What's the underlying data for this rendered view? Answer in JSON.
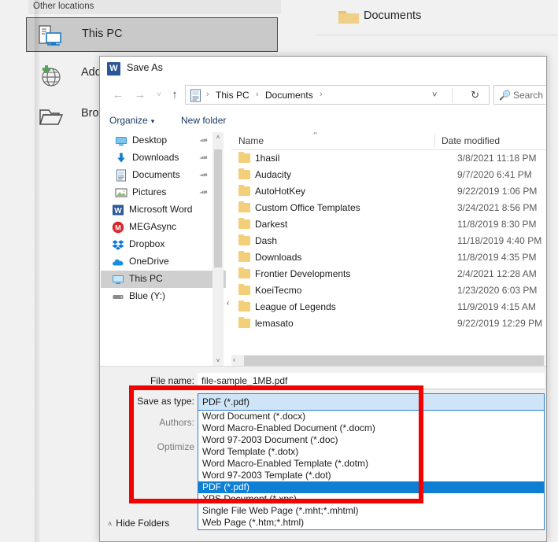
{
  "backstage": {
    "other_locations_label": "Other locations",
    "places": [
      {
        "label": "This PC",
        "icon": "this-pc-icon",
        "selected": true
      },
      {
        "label": "Add a Place",
        "icon": "add-place-globe-icon",
        "selected": false
      },
      {
        "label": "Browse",
        "icon": "browse-folder-icon",
        "selected": false
      }
    ],
    "current_folder": {
      "label": "Documents",
      "icon": "folder-icon"
    }
  },
  "dialog": {
    "title": "Save As",
    "app_icon": "word-icon",
    "app_icon_letter": "W",
    "nav": {
      "back": "←",
      "forward": "→",
      "recent": "˅",
      "up": "↑"
    },
    "address": {
      "icon": "documents-library-icon",
      "crumbs": [
        "This PC",
        "Documents"
      ],
      "separator": "›",
      "dropdown_caret": "˅",
      "refresh": "↻"
    },
    "search": {
      "icon": "search-icon",
      "placeholder": "Search D"
    },
    "commands": {
      "organize": "Organize",
      "organize_caret": "▾",
      "new_folder": "New folder"
    },
    "nav_pane": {
      "items": [
        {
          "label": "Desktop",
          "icon": "desktop-icon",
          "pinned": true,
          "child": true,
          "selected": false
        },
        {
          "label": "Downloads",
          "icon": "downloads-icon",
          "pinned": true,
          "child": true,
          "selected": false
        },
        {
          "label": "Documents",
          "icon": "documents-icon",
          "pinned": true,
          "child": true,
          "selected": false
        },
        {
          "label": "Pictures",
          "icon": "pictures-icon",
          "pinned": true,
          "child": true,
          "selected": false
        },
        {
          "label": "Microsoft Word",
          "icon": "word-icon",
          "pinned": false,
          "child": false,
          "selected": false
        },
        {
          "label": "MEGAsync",
          "icon": "megasync-icon",
          "pinned": false,
          "child": false,
          "selected": false
        },
        {
          "label": "Dropbox",
          "icon": "dropbox-icon",
          "pinned": false,
          "child": false,
          "selected": false
        },
        {
          "label": "OneDrive",
          "icon": "onedrive-icon",
          "pinned": false,
          "child": false,
          "selected": false
        },
        {
          "label": "This PC",
          "icon": "this-pc-icon",
          "pinned": false,
          "child": false,
          "selected": true
        },
        {
          "label": "Blue (Y:)",
          "icon": "drive-icon",
          "pinned": false,
          "child": false,
          "selected": false
        }
      ],
      "scroll_up": "˄",
      "scroll_down": "˅",
      "splitter_arrow": "‹"
    },
    "file_list": {
      "columns": [
        "Name",
        "Date modified"
      ],
      "sort_caret": "˄",
      "rows": [
        {
          "name": "1hasil",
          "date": "3/8/2021 11:18 PM"
        },
        {
          "name": "Audacity",
          "date": "9/7/2020 6:41 PM"
        },
        {
          "name": "AutoHotKey",
          "date": "9/22/2019 1:06 PM"
        },
        {
          "name": "Custom Office Templates",
          "date": "3/24/2021 8:56 PM"
        },
        {
          "name": "Darkest",
          "date": "11/8/2019 8:30 PM"
        },
        {
          "name": "Dash",
          "date": "11/18/2019 4:40 PM"
        },
        {
          "name": "Downloads",
          "date": "11/8/2019 4:35 PM"
        },
        {
          "name": "Frontier Developments",
          "date": "2/4/2021 12:28 AM"
        },
        {
          "name": "KoeiTecmo",
          "date": "1/23/2020 6:03 PM"
        },
        {
          "name": "League of Legends",
          "date": "11/9/2019 4:15 AM"
        },
        {
          "name": "lemasato",
          "date": "9/22/2019 12:29 PM"
        }
      ],
      "hscroll_left_arrow": "‹"
    },
    "form": {
      "file_name_label": "File name:",
      "file_name_value": "file-sample_1MB.pdf",
      "save_as_type_label": "Save as type:",
      "save_as_type_value": "PDF (*.pdf)",
      "authors_label": "Authors:",
      "optimize_label": "Optimize",
      "hide_folders_label": "Hide Folders",
      "hide_folders_chevron": "˄"
    },
    "type_dropdown": {
      "selected_value": "PDF (*.pdf)",
      "options": [
        "Word Document (*.docx)",
        "Word Macro-Enabled Document (*.docm)",
        "Word 97-2003 Document (*.doc)",
        "Word Template (*.dotx)",
        "Word Macro-Enabled Template (*.dotm)",
        "Word 97-2003 Template (*.dot)",
        "PDF (*.pdf)",
        "XPS Document (*.xps)",
        "Single File Web Page (*.mht;*.mhtml)",
        "Web Page (*.htm;*.html)"
      ],
      "selected_index": 6
    }
  },
  "annotation": {
    "highlight_color": "#f30000",
    "shape": "rectangle"
  },
  "colors": {
    "accent_blue": "#0f7fd4",
    "combo_fill": "#cfe4f7",
    "folder_yellow": "#f3cf7a",
    "word_blue": "#2b579a",
    "backstage_bg": "#f1f1f1"
  }
}
